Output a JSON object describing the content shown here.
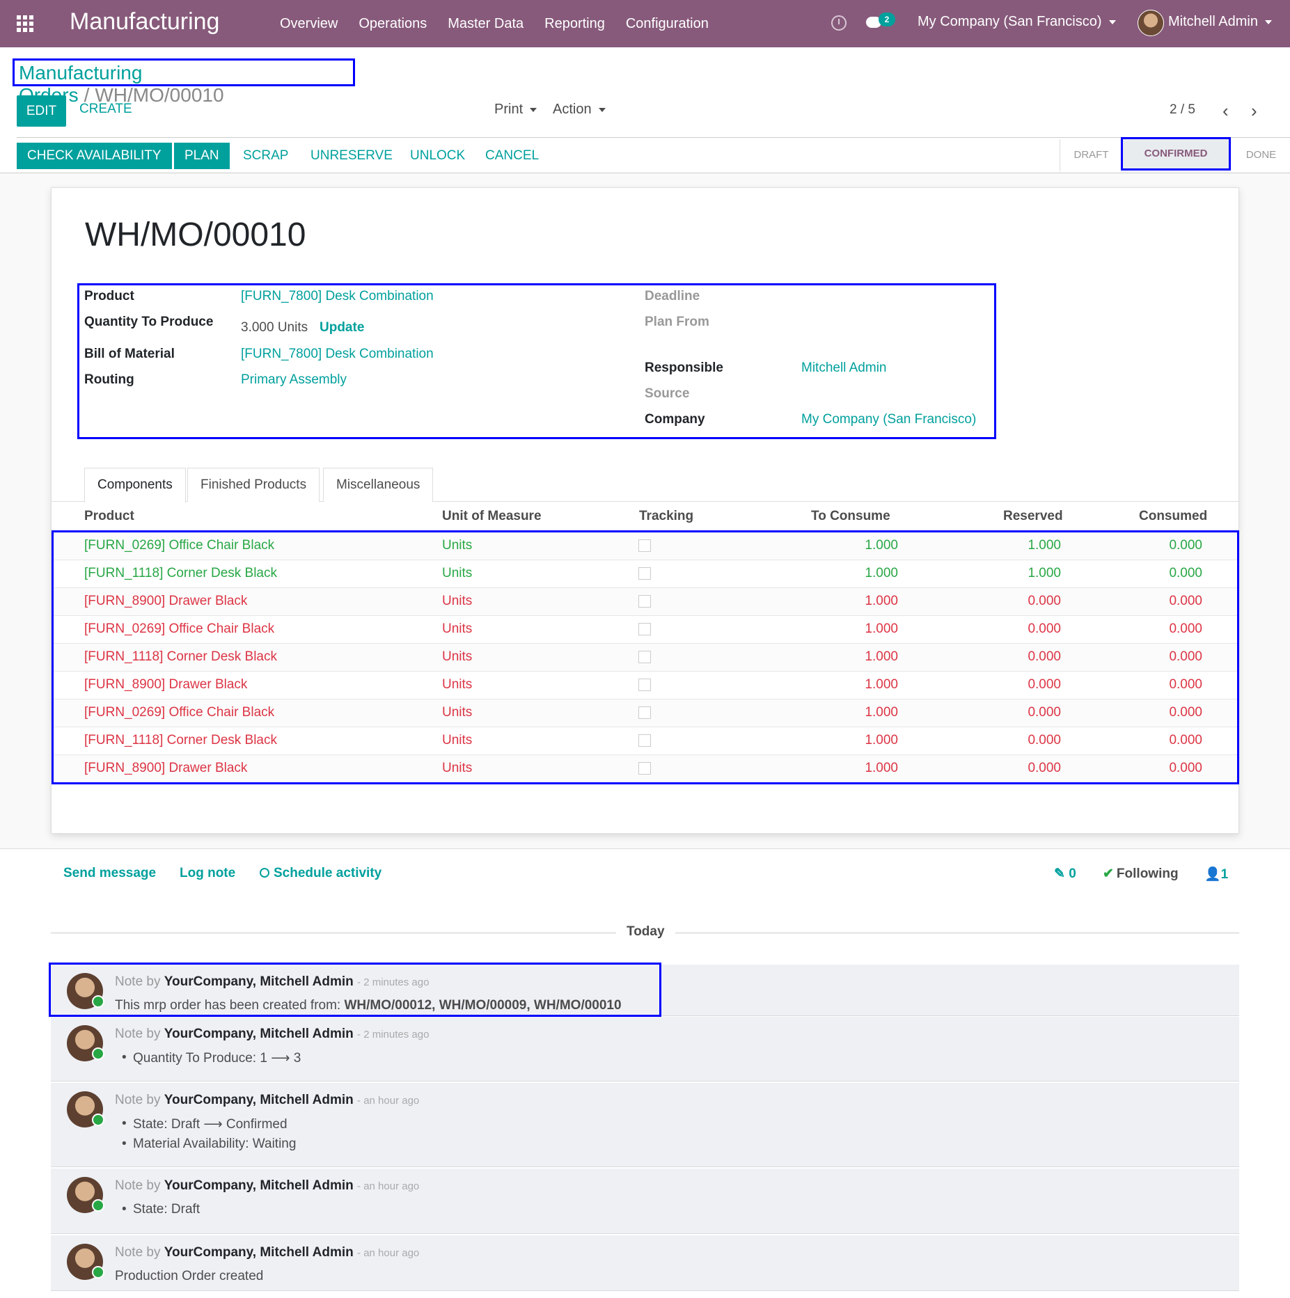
{
  "navbar": {
    "app_name": "Manufacturing",
    "menus": [
      "Overview",
      "Operations",
      "Master Data",
      "Reporting",
      "Configuration"
    ],
    "chat_badge": "2",
    "company": "My Company (San Francisco)",
    "user": "Mitchell Admin"
  },
  "breadcrumb": {
    "parent": "Manufacturing Orders",
    "separator": "/",
    "current": "WH/MO/00010"
  },
  "controls": {
    "edit": "EDIT",
    "create": "CREATE",
    "print": "Print",
    "action": "Action",
    "pager": "2 / 5"
  },
  "statusbar": {
    "buttons": [
      "CHECK AVAILABILITY",
      "PLAN",
      "SCRAP",
      "UNRESERVE",
      "UNLOCK",
      "CANCEL"
    ],
    "stages": {
      "draft": "DRAFT",
      "confirmed": "CONFIRMED",
      "done": "DONE"
    }
  },
  "form": {
    "title": "WH/MO/00010",
    "product_label": "Product",
    "product": "[FURN_7800] Desk Combination",
    "qty_label": "Quantity To Produce",
    "qty": "3.000 Units",
    "update": "Update",
    "bom_label": "Bill of Material",
    "bom": "[FURN_7800] Desk Combination",
    "routing_label": "Routing",
    "routing": "Primary Assembly",
    "deadline_label": "Deadline",
    "plan_from_label": "Plan From",
    "responsible_label": "Responsible",
    "responsible": "Mitchell Admin",
    "source_label": "Source",
    "company_label": "Company",
    "company": "My Company (San Francisco)"
  },
  "tabs": [
    "Components",
    "Finished Products",
    "Miscellaneous"
  ],
  "table": {
    "headers": [
      "Product",
      "Unit of Measure",
      "Tracking",
      "To Consume",
      "Reserved",
      "Consumed"
    ],
    "rows": [
      {
        "product": "[FURN_0269] Office Chair Black",
        "uom": "Units",
        "to_consume": "1.000",
        "reserved": "1.000",
        "consumed": "0.000",
        "status": "available"
      },
      {
        "product": "[FURN_1118] Corner Desk Black",
        "uom": "Units",
        "to_consume": "1.000",
        "reserved": "1.000",
        "consumed": "0.000",
        "status": "available"
      },
      {
        "product": "[FURN_8900] Drawer Black",
        "uom": "Units",
        "to_consume": "1.000",
        "reserved": "0.000",
        "consumed": "0.000",
        "status": "waiting"
      },
      {
        "product": "[FURN_0269] Office Chair Black",
        "uom": "Units",
        "to_consume": "1.000",
        "reserved": "0.000",
        "consumed": "0.000",
        "status": "waiting"
      },
      {
        "product": "[FURN_1118] Corner Desk Black",
        "uom": "Units",
        "to_consume": "1.000",
        "reserved": "0.000",
        "consumed": "0.000",
        "status": "waiting"
      },
      {
        "product": "[FURN_8900] Drawer Black",
        "uom": "Units",
        "to_consume": "1.000",
        "reserved": "0.000",
        "consumed": "0.000",
        "status": "waiting"
      },
      {
        "product": "[FURN_0269] Office Chair Black",
        "uom": "Units",
        "to_consume": "1.000",
        "reserved": "0.000",
        "consumed": "0.000",
        "status": "waiting"
      },
      {
        "product": "[FURN_1118] Corner Desk Black",
        "uom": "Units",
        "to_consume": "1.000",
        "reserved": "0.000",
        "consumed": "0.000",
        "status": "waiting"
      },
      {
        "product": "[FURN_8900] Drawer Black",
        "uom": "Units",
        "to_consume": "1.000",
        "reserved": "0.000",
        "consumed": "0.000",
        "status": "waiting"
      }
    ]
  },
  "chatter": {
    "send_message": "Send message",
    "log_note": "Log note",
    "schedule_activity": "Schedule activity",
    "attachments": "0",
    "following": "Following",
    "followers": "1",
    "today": "Today",
    "messages": [
      {
        "prefix": "Note by",
        "author": "YourCompany, Mitchell Admin",
        "when": "- 2 minutes ago",
        "body_prefix": "This mrp order has been created from:",
        "body_bold": "WH/MO/00012, WH/MO/00009, WH/MO/00010"
      },
      {
        "prefix": "Note by",
        "author": "YourCompany, Mitchell Admin",
        "when": "- 2 minutes ago",
        "tracking": [
          "Quantity To Produce: 1 ⟶ 3"
        ]
      },
      {
        "prefix": "Note by",
        "author": "YourCompany, Mitchell Admin",
        "when": "- an hour ago",
        "tracking": [
          "State: Draft ⟶ Confirmed",
          "Material Availability: Waiting"
        ]
      },
      {
        "prefix": "Note by",
        "author": "YourCompany, Mitchell Admin",
        "when": "- an hour ago",
        "tracking": [
          "State: Draft"
        ]
      },
      {
        "prefix": "Note by",
        "author": "YourCompany, Mitchell Admin",
        "when": "- an hour ago",
        "body_prefix": "Production Order created"
      }
    ]
  }
}
